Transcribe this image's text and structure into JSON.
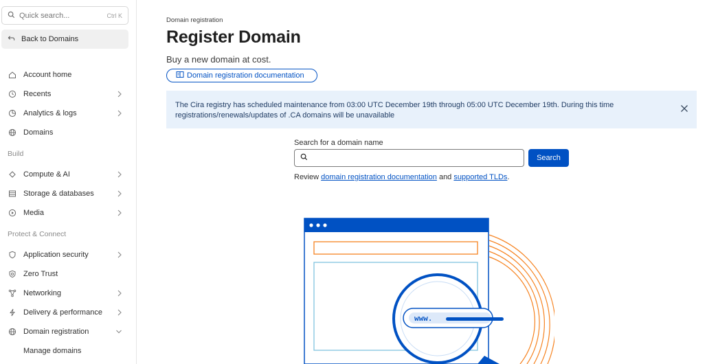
{
  "sidebar": {
    "search": {
      "placeholder": "Quick search...",
      "shortcut": "Ctrl K"
    },
    "back_label": "Back to Domains",
    "items": [
      {
        "label": "Account home",
        "icon": "home-icon",
        "chevron": false
      },
      {
        "label": "Recents",
        "icon": "clock-icon",
        "chevron": true
      },
      {
        "label": "Analytics & logs",
        "icon": "chart-icon",
        "chevron": true
      },
      {
        "label": "Domains",
        "icon": "globe-icon",
        "chevron": false
      }
    ],
    "section_build": "Build",
    "build_items": [
      {
        "label": "Compute & AI",
        "icon": "compute-icon",
        "chevron": true
      },
      {
        "label": "Storage & databases",
        "icon": "storage-icon",
        "chevron": true
      },
      {
        "label": "Media",
        "icon": "media-icon",
        "chevron": true
      }
    ],
    "section_protect": "Protect & Connect",
    "protect_items": [
      {
        "label": "Application security",
        "icon": "shield-icon",
        "chevron": true
      },
      {
        "label": "Zero Trust",
        "icon": "zero-trust-icon",
        "chevron": false
      },
      {
        "label": "Networking",
        "icon": "network-icon",
        "chevron": true
      },
      {
        "label": "Delivery & performance",
        "icon": "bolt-icon",
        "chevron": true
      },
      {
        "label": "Domain registration",
        "icon": "globe-icon",
        "chevron": "down"
      }
    ],
    "sub_item": "Manage domains"
  },
  "main": {
    "breadcrumb": "Domain registration",
    "title": "Register Domain",
    "subtitle": "Buy a new domain at cost.",
    "doc_link": "Domain registration documentation",
    "banner": {
      "line1": "The Cira registry has scheduled maintenance from 03:00 UTC December 19th through 05:00 UTC December 19th. During this time",
      "line2": "registrations/renewals/updates of .CA domains will be unavailable"
    },
    "search": {
      "label": "Search for a domain name",
      "value": "",
      "button": "Search"
    },
    "review": {
      "prefix": "Review ",
      "link1": "domain registration documentation",
      "middle": " and ",
      "link2": "supported TLDs",
      "suffix": "."
    },
    "illustration": {
      "url_text": "www."
    }
  },
  "colors": {
    "accent": "#0051c3",
    "banner_bg": "#e8f1fb",
    "orange": "#f6821f"
  }
}
